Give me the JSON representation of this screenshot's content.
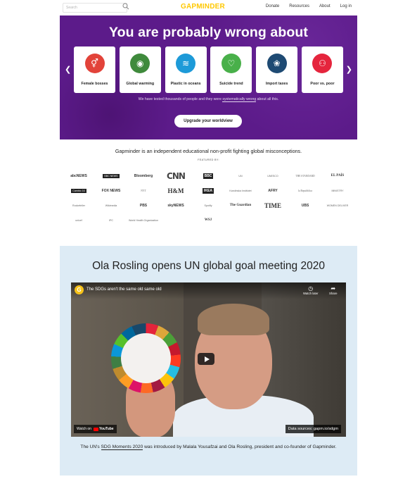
{
  "header": {
    "search_placeholder": "Search",
    "logo": "GAPMINDER",
    "nav": [
      "Donate",
      "Resources",
      "About",
      "Log in"
    ]
  },
  "hero": {
    "title": "You are probably wrong about",
    "cards": [
      {
        "label": "Female bosses",
        "color": "#e2433a",
        "icon": "gender-icon",
        "glyph": "⚥"
      },
      {
        "label": "Global warming",
        "color": "#3f8a3c",
        "icon": "eye-icon",
        "glyph": "◉"
      },
      {
        "label": "Plastic in oceans",
        "color": "#1d9ad8",
        "icon": "waves-icon",
        "glyph": "≋"
      },
      {
        "label": "Suicide trend",
        "color": "#49b04a",
        "icon": "heartbeat-icon",
        "glyph": "♡"
      },
      {
        "label": "Import taxes",
        "color": "#1e4a73",
        "icon": "dove-icon",
        "glyph": "❀"
      },
      {
        "label": "Poor vs. poor",
        "color": "#e5253d",
        "icon": "people-icon",
        "glyph": "⚇"
      }
    ],
    "sub_before": "We have tested thousands of people and they were ",
    "sub_link": "systematically wrong",
    "sub_after": " about all this.",
    "cta": "Upgrade your worldview"
  },
  "tagline": "Gapminder is an independent educational non-profit fighting global misconceptions.",
  "featured_label": "FEATURED BY:",
  "logos": [
    "abcNEWS",
    "BBC NEWS",
    "Bloomberg",
    "CNN",
    "BBC",
    "UN",
    "UNESCO",
    "THE STANDARD",
    "EL PAÍS",
    "Cambio 16",
    "FOX NEWS",
    "NYT",
    "H&M",
    "IKEA",
    "Karolinska Institutet",
    "AFRY",
    "la Repubblica",
    "MINISTRY",
    "Rockefeller",
    "Wikimedia",
    "PBS",
    "skyNEWS",
    "Spotify",
    "The Guardian",
    "TIME",
    "UBS",
    "unicef",
    "IPC",
    "World Health Organization",
    "WOMEN DELIVER",
    "WSJ"
  ],
  "video": {
    "section_title": "Ola Rosling opens UN global goal meeting 2020",
    "video_title": "The SDGs aren't the same old same old",
    "watch_later": "Watch later",
    "share": "Share",
    "watch_on": "Watch on",
    "youtube": "YouTube",
    "data_source": "Data sources: gapm.io/sdgm",
    "caption_before": "The UN's ",
    "caption_link": "SDG Moments 2020",
    "caption_after": " was introduced by Malala Yousafzai and Ola Rosling, president and co-founder of Gapminder."
  }
}
